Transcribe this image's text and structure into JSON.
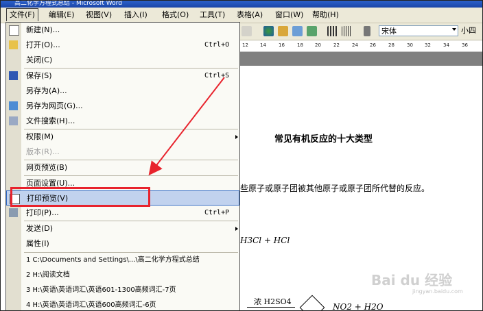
{
  "titlebar": {
    "title": "高二化学方程式总结 - Microsoft Word"
  },
  "menubar": {
    "items": [
      "文件(F)",
      "编辑(E)",
      "视图(V)",
      "插入(I)",
      "格式(O)",
      "工具(T)",
      "表格(A)",
      "窗口(W)",
      "帮助(H)"
    ]
  },
  "toolbar": {
    "font_name": "宋体",
    "font_size": "小四"
  },
  "ruler": {
    "numbers": [
      "12",
      "14",
      "16",
      "18",
      "20",
      "22",
      "24",
      "26",
      "28",
      "30",
      "32",
      "34",
      "36"
    ]
  },
  "file_menu": {
    "items": [
      {
        "label": "新建(N)...",
        "shortcut": ""
      },
      {
        "label": "打开(O)...",
        "shortcut": "Ctrl+O"
      },
      {
        "label": "关闭(C)",
        "shortcut": ""
      },
      {
        "label": "保存(S)",
        "shortcut": "Ctrl+S"
      },
      {
        "label": "另存为(A)...",
        "shortcut": ""
      },
      {
        "label": "另存为网页(G)...",
        "shortcut": ""
      },
      {
        "label": "文件搜索(H)...",
        "shortcut": ""
      },
      {
        "label": "权限(M)",
        "shortcut": ""
      },
      {
        "label": "版本(R)...",
        "shortcut": ""
      },
      {
        "label": "网页预览(B)",
        "shortcut": ""
      },
      {
        "label": "页面设置(U)...",
        "shortcut": ""
      },
      {
        "label": "打印预览(V)",
        "shortcut": ""
      },
      {
        "label": "打印(P)...",
        "shortcut": "Ctrl+P"
      },
      {
        "label": "发送(D)",
        "shortcut": ""
      },
      {
        "label": "属性(I)",
        "shortcut": ""
      }
    ],
    "recent": [
      "1 C:\\Documents and Settings\\...\\高二化学方程式总结",
      "2 H:\\阅读文档",
      "3 H:\\英语\\英语词汇\\英语601-1300高频词汇-7页",
      "4 H:\\英语\\英语词汇\\英语600高频词汇-6页"
    ]
  },
  "document": {
    "title": "常见有机反应的十大类型",
    "line1": "些原子或原子团被其他原子或原子团所代替的反应。",
    "formula1": "H3Cl + HCl",
    "formula2_condition": "浓 H2SO4",
    "formula2_product": "NO2 + H2O"
  },
  "watermark": {
    "text": "Bai du 经验",
    "sub": "jingyan.baidu.com"
  },
  "colors": {
    "highlight": "#c1d2ee",
    "annotation_red": "#e8232d",
    "menubar": "#ece9d8"
  }
}
